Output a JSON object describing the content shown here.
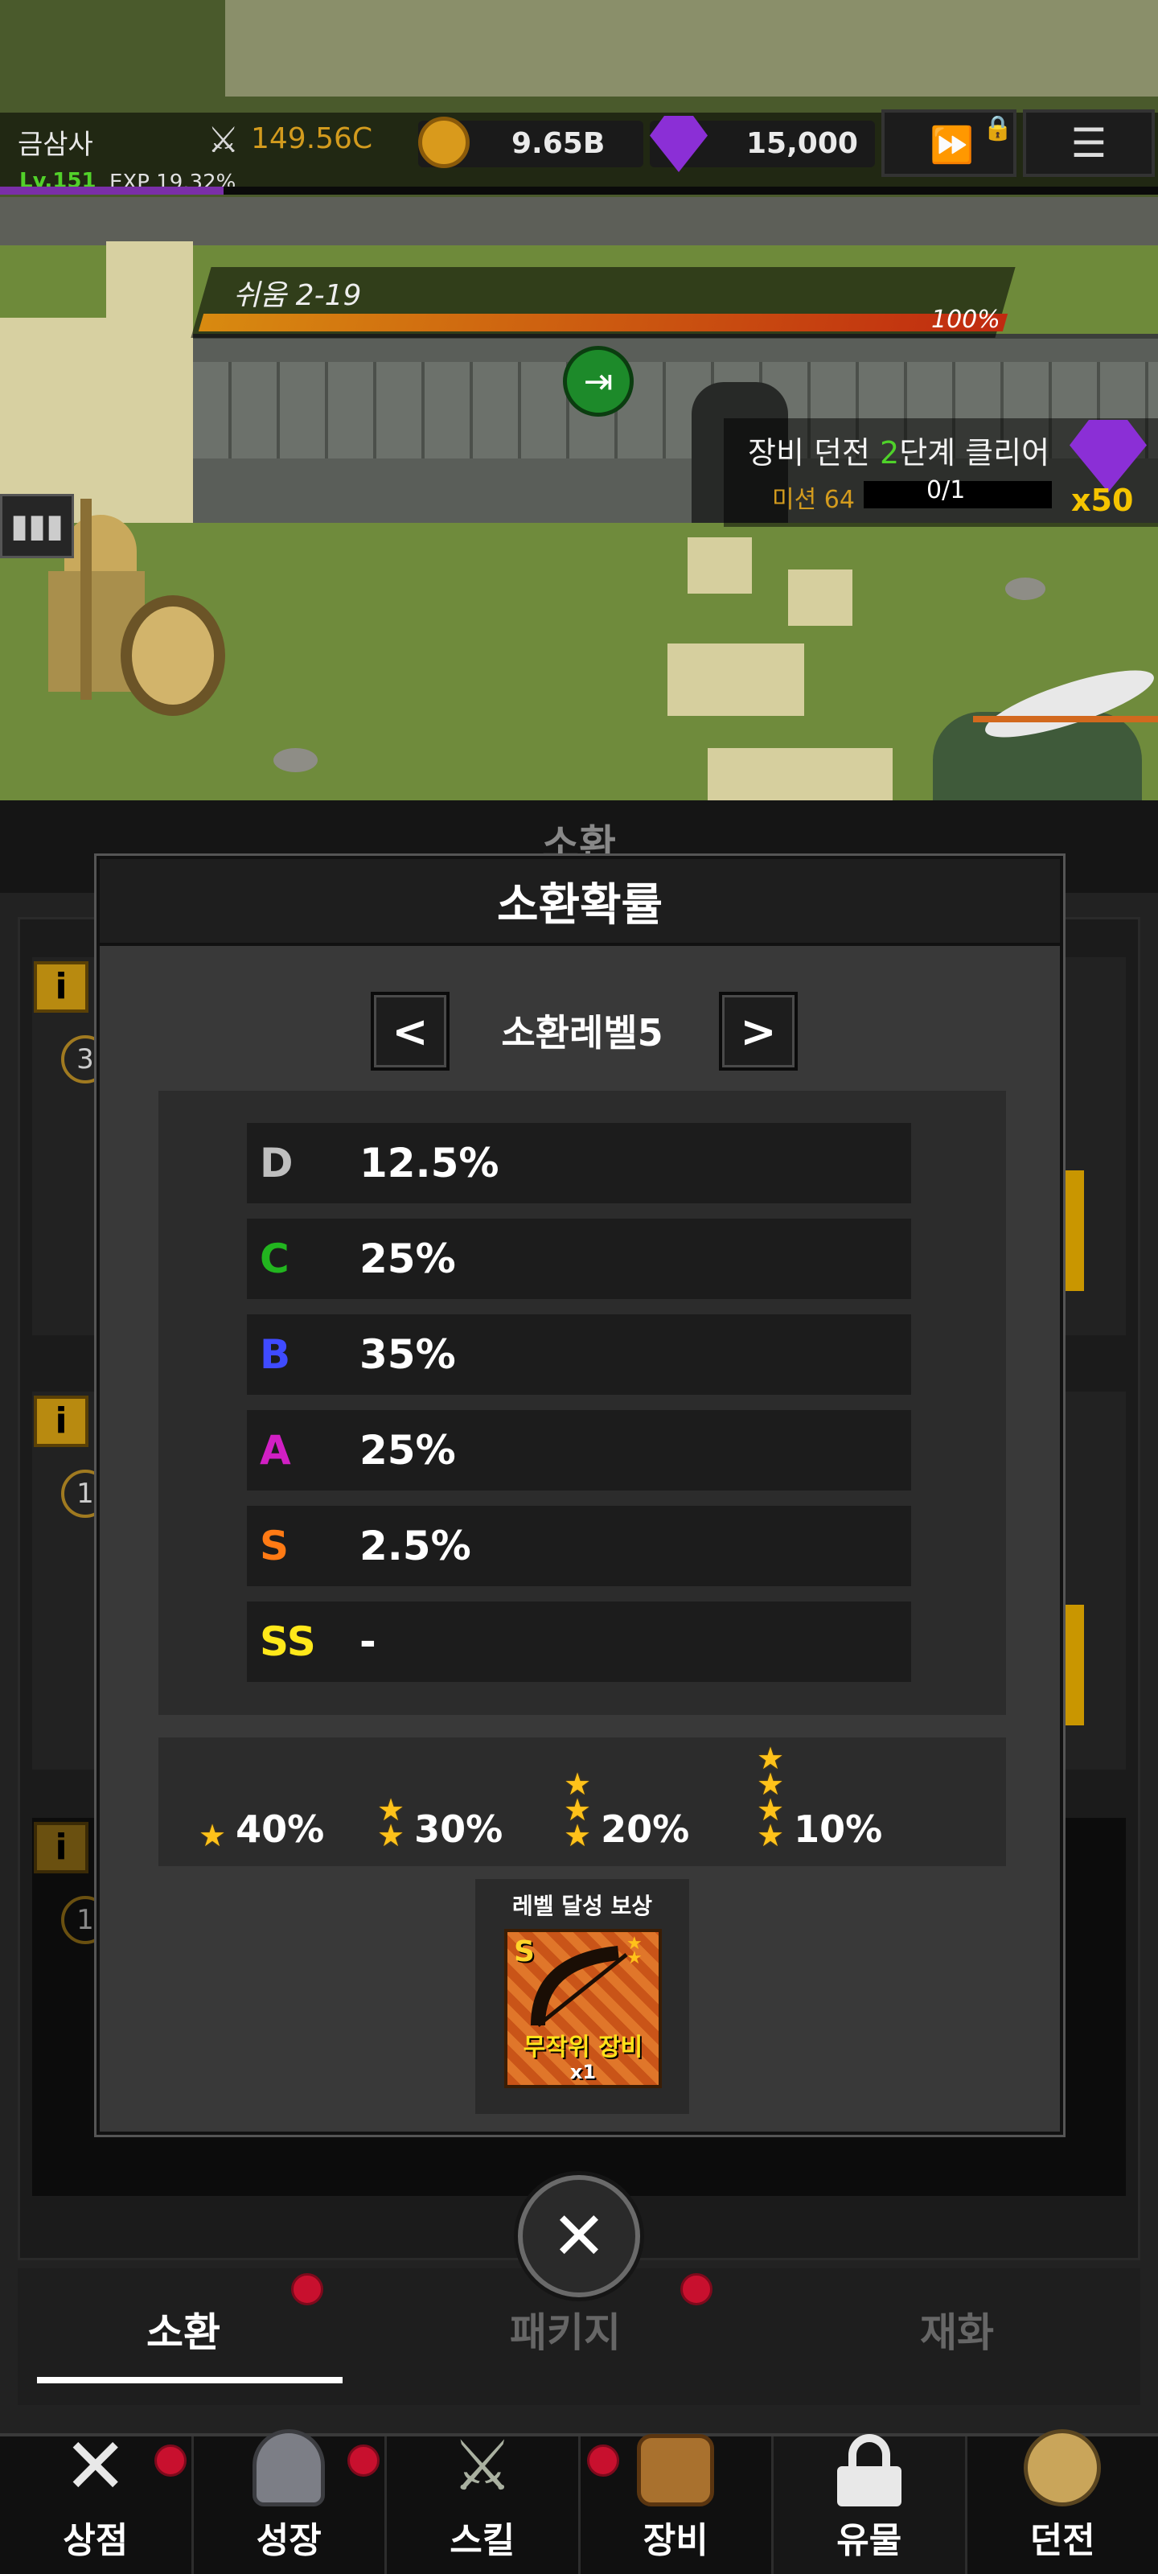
{
  "hud": {
    "player_name": "금삼사",
    "level": "Lv.151",
    "exp": "EXP 19.32%",
    "attack_power": "149.56C",
    "gold": "9.65B",
    "gems": "15,000"
  },
  "stage": {
    "name": "쉬움 2-19",
    "progress": "100%",
    "progress_value": 1.0
  },
  "mission": {
    "title_prefix": "장비 던전 ",
    "title_num": "2",
    "title_suffix": "단계 클리어",
    "label": "미션 64",
    "count": "0/1",
    "reward_count": "x50"
  },
  "panel_header": "소환",
  "modal": {
    "title": "소환확률",
    "prev_label": "<",
    "next_label": ">",
    "level_label": "소환레벨5",
    "rates": [
      {
        "grade": "D",
        "value": "12.5%",
        "color": "#bfbfbf"
      },
      {
        "grade": "C",
        "value": "25%",
        "color": "#22b51f"
      },
      {
        "grade": "B",
        "value": "35%",
        "color": "#3f4bff"
      },
      {
        "grade": "A",
        "value": "25%",
        "color": "#d11fc4"
      },
      {
        "grade": "S",
        "value": "2.5%",
        "color": "#ff7a14"
      },
      {
        "grade": "SS",
        "value": "-",
        "color": "#ffe81a"
      }
    ],
    "star_rates": [
      {
        "stars": 1,
        "value": "40%"
      },
      {
        "stars": 2,
        "value": "30%"
      },
      {
        "stars": 3,
        "value": "20%"
      },
      {
        "stars": 4,
        "value": "10%"
      }
    ],
    "reward": {
      "title": "레벨 달성 보상",
      "grade": "S",
      "name": "무작위 장비",
      "count": "x1"
    }
  },
  "close_label": "✕",
  "tabs": [
    {
      "label": "소환",
      "active": true
    },
    {
      "label": "패키지",
      "active": false
    },
    {
      "label": "재화",
      "active": false
    }
  ],
  "bottom_nav": [
    {
      "label": "상점",
      "icon": "crossed-swords-icon"
    },
    {
      "label": "성장",
      "icon": "helmet-icon"
    },
    {
      "label": "스킬",
      "icon": "swords-icon"
    },
    {
      "label": "장비",
      "icon": "backpack-icon"
    },
    {
      "label": "유물",
      "icon": "lock-icon"
    },
    {
      "label": "던전",
      "icon": "skull-icon"
    }
  ],
  "colors": {
    "accent_gold": "#f5c400",
    "notification": "#c8102e",
    "gem_purple": "#8b2fd6"
  }
}
